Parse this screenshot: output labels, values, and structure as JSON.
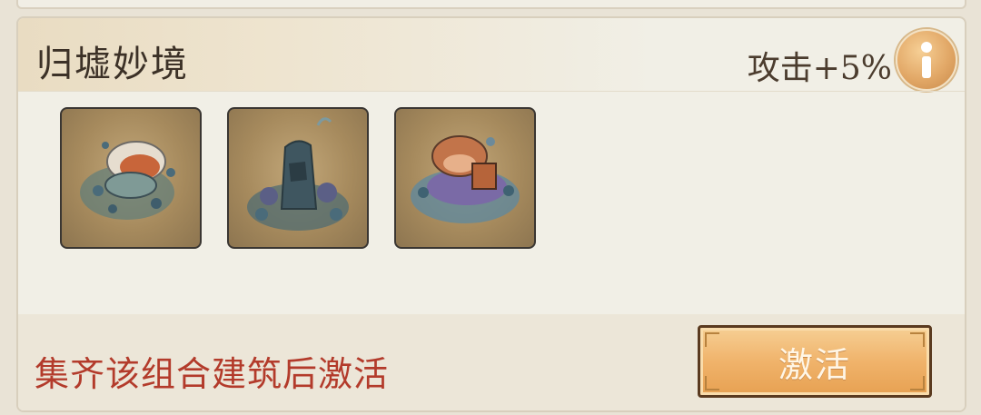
{
  "panel": {
    "title": "归墟妙境",
    "bonus": "攻击+5%",
    "info_icon": "info-icon"
  },
  "buildings": [
    {
      "name": "building-shell-pavilion",
      "icon": "building-icon"
    },
    {
      "name": "building-rock-tower",
      "icon": "building-icon"
    },
    {
      "name": "building-coral-house",
      "icon": "building-icon"
    }
  ],
  "footer": {
    "hint": "集齐该组合建筑后激活",
    "activate_label": "激活"
  },
  "colors": {
    "hint_red": "#b33b2b",
    "button_orange": "#f0b36b",
    "title_text": "#3c3127"
  }
}
